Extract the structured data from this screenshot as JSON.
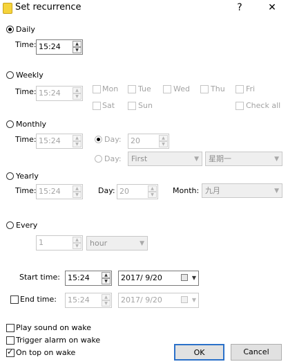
{
  "window": {
    "title": "Set recurrence",
    "help": "?",
    "close": "✕"
  },
  "time_label": "Time:",
  "daily": {
    "label": "Daily",
    "time": "15:24"
  },
  "weekly": {
    "label": "Weekly",
    "time": "15:24",
    "days": [
      "Mon",
      "Tue",
      "Wed",
      "Thu",
      "Fri",
      "Sat",
      "Sun"
    ],
    "check_all": "Check all"
  },
  "monthly": {
    "label": "Monthly",
    "time": "15:24",
    "day_label": "Day:",
    "day_value": "20",
    "week_value": "First",
    "weekday_value": "星期一"
  },
  "yearly": {
    "label": "Yearly",
    "time": "15:24",
    "day_label": "Day:",
    "day_value": "20",
    "month_label": "Month:",
    "month_value": "九月"
  },
  "every": {
    "label": "Every",
    "value": "1",
    "unit": "hour"
  },
  "start": {
    "label": "Start time:",
    "time": "15:24",
    "date": "2017/ 9/20"
  },
  "end": {
    "label": "End time:",
    "time": "15:24",
    "date": "2017/ 9/20"
  },
  "options": {
    "play_sound": "Play sound on wake",
    "trigger_alarm": "Trigger alarm on wake",
    "on_top": "On top on wake"
  },
  "buttons": {
    "ok": "OK",
    "cancel": "Cancel"
  },
  "icons": {
    "app": "sticky-note-icon",
    "spin_up": "▲",
    "spin_down": "▼",
    "dropdown": "▼"
  },
  "colors": {
    "primary_border": "#2a70c9",
    "disabled_text": "#a3a3a3",
    "app_icon": "#f5d33b"
  }
}
